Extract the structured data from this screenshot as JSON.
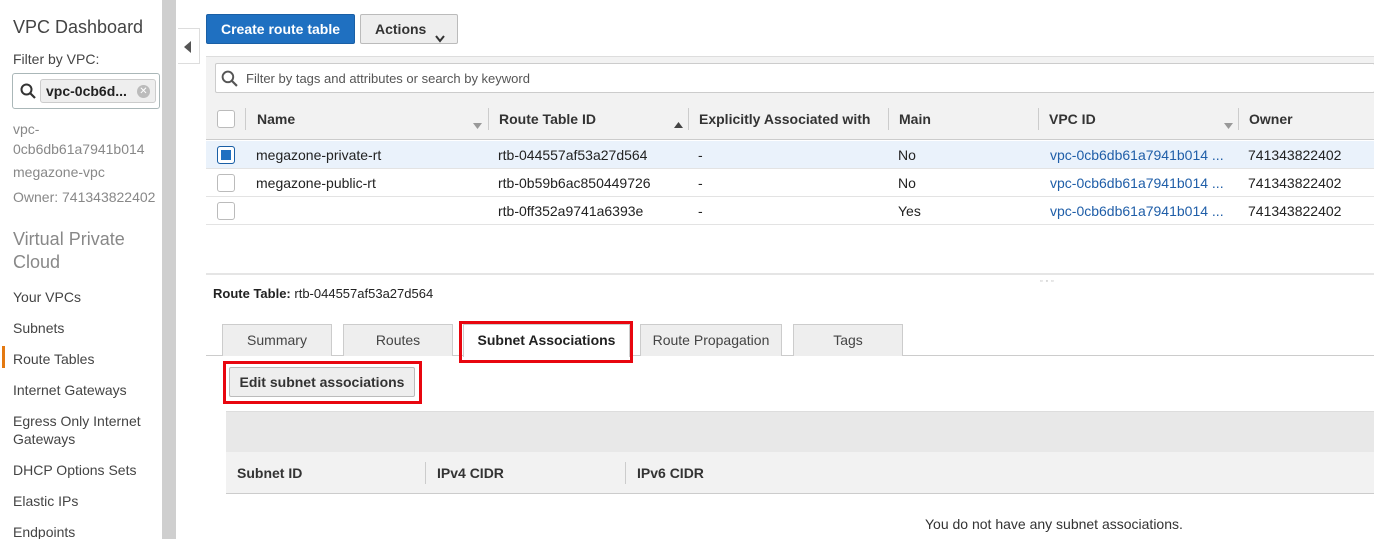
{
  "sidebar": {
    "title": "VPC Dashboard",
    "filter_label": "Filter by VPC:",
    "filter_chip": "vpc-0cb6d...",
    "vpc_id_line1": "vpc-",
    "vpc_id_line2": "0cb6db61a7941b014",
    "vpc_name": "megazone-vpc",
    "owner": "Owner: 741343822402",
    "section_title": "Virtual Private Cloud",
    "items": [
      {
        "label": "Your VPCs"
      },
      {
        "label": "Subnets"
      },
      {
        "label": "Route Tables",
        "active": true
      },
      {
        "label": "Internet Gateways"
      },
      {
        "label": "Egress Only Internet Gateways"
      },
      {
        "label": "DHCP Options Sets"
      },
      {
        "label": "Elastic IPs"
      },
      {
        "label": "Endpoints"
      }
    ]
  },
  "toolbar": {
    "create_label": "Create route table",
    "actions_label": "Actions"
  },
  "search": {
    "placeholder": "Filter by tags and attributes or search by keyword"
  },
  "table": {
    "columns": [
      "Name",
      "Route Table ID",
      "Explicitly Associated with",
      "Main",
      "VPC ID",
      "Owner"
    ],
    "rows": [
      {
        "selected": true,
        "name": "megazone-private-rt",
        "route_table_id": "rtb-044557af53a27d564",
        "explicit": "-",
        "main": "No",
        "vpc_id": "vpc-0cb6db61a7941b014 ...",
        "owner": "741343822402"
      },
      {
        "selected": false,
        "name": "megazone-public-rt",
        "route_table_id": "rtb-0b59b6ac850449726",
        "explicit": "-",
        "main": "No",
        "vpc_id": "vpc-0cb6db61a7941b014 ...",
        "owner": "741343822402"
      },
      {
        "selected": false,
        "name": "",
        "route_table_id": "rtb-0ff352a9741a6393e",
        "explicit": "-",
        "main": "Yes",
        "vpc_id": "vpc-0cb6db61a7941b014 ...",
        "owner": "741343822402"
      }
    ]
  },
  "detail": {
    "label": "Route Table:",
    "value": "rtb-044557af53a27d564",
    "tabs": [
      "Summary",
      "Routes",
      "Subnet Associations",
      "Route Propagation",
      "Tags"
    ],
    "active_tab": "Subnet Associations",
    "edit_button": "Edit subnet associations",
    "sub_columns": [
      "Subnet ID",
      "IPv4 CIDR",
      "IPv6 CIDR"
    ],
    "empty_message": "You do not have any subnet associations."
  },
  "colors": {
    "primary": "#1f70c1",
    "highlight": "#e8060f",
    "link": "#1f5ea8",
    "active_nav": "#e47911"
  }
}
